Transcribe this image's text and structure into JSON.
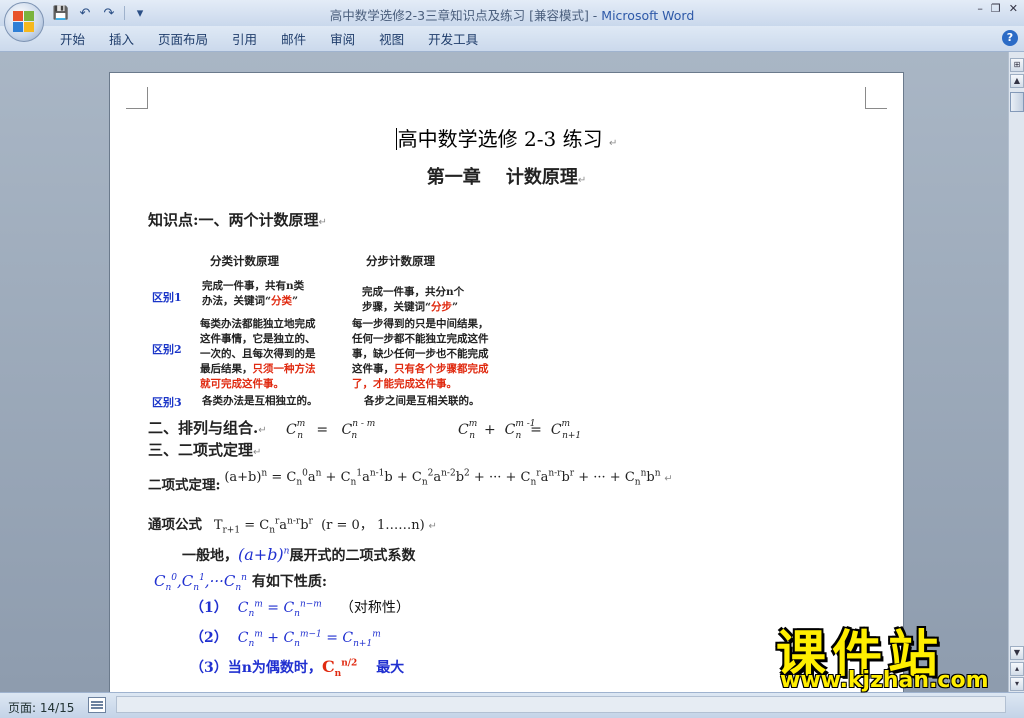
{
  "window": {
    "title": "高中数学选修2-3三章知识点及练习 [兼容模式] - ",
    "app_name": "Microsoft Word",
    "controls": [
      "–",
      "❐",
      "✕"
    ]
  },
  "qat": {
    "save": "💾",
    "undo": "↶",
    "redo": "↷",
    "more": "▾"
  },
  "ribbon": {
    "tabs": [
      "开始",
      "插入",
      "页面布局",
      "引用",
      "邮件",
      "审阅",
      "视图",
      "开发工具"
    ],
    "help": "?"
  },
  "document": {
    "title": "高中数学选修 2-3 练习",
    "chapter": "第一章    计数原理",
    "knowledge": "知识点:一、两个计数原理",
    "paragraph_mark": "↵",
    "compare": {
      "col1_header": "分类计数原理",
      "col2_header": "分步计数原理",
      "rows": [
        {
          "label": "区别1",
          "c1_a": "完成一件事，共有n类",
          "c1_b": "办法，关键词“",
          "c1_red": "分类",
          "c1_end": "”",
          "c2_a": "完成一件事，共分n个",
          "c2_b": "步骤，关键词“",
          "c2_red": "分步",
          "c2_end": "”"
        },
        {
          "label": "区别2",
          "c1_lines": [
            "每类办法都能独立地完成",
            "这件事情，它是独立的、",
            "一次的、且每次得到的是"
          ],
          "c1_last_black": "最后结果，",
          "c1_last_red": "只须一种方法",
          "c1_red_line": "就可完成这件事。",
          "c2_lines": [
            "每一步得到的只是中间结果，",
            "任何一步都不能独立完成这件",
            "事，缺少任何一步也不能完成"
          ],
          "c2_last_black": "这件事，",
          "c2_last_red": "只有各个步骤都完成",
          "c2_red_line": "了，才能完成这件事。"
        },
        {
          "label": "区别3",
          "c1": "各类办法是互相独立的。",
          "c2": "各步之间是互相关联的。"
        }
      ]
    },
    "section2": "二、排列与组合.",
    "section3": "三、二项式定理",
    "binomial_label": "二项式定理:",
    "term_label": "通项公式",
    "general_pre": "一般地，",
    "general_post": "展开式的二项式系数",
    "props_post": "有如下性质:",
    "prop1_num": "（1）",
    "prop1_note": "（对称性）",
    "prop2_num": "（2）",
    "prop3_num": "（3）",
    "prop3_text": "当n为偶数时，",
    "prop3_tail": "最大"
  },
  "status": {
    "page": "页面: 14/15"
  },
  "watermark": {
    "main": "课件站",
    "url": "www.kjzhan.com"
  }
}
